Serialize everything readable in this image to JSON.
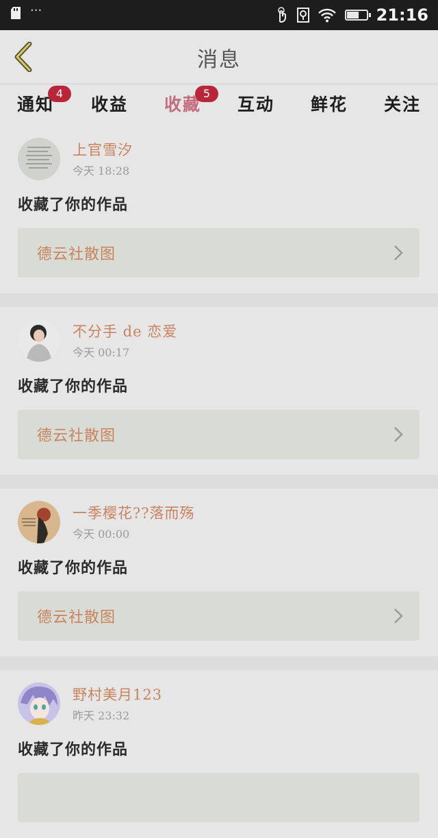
{
  "status_bar": {
    "time": "21:16",
    "dots": "···",
    "battery_level": 0.6
  },
  "header": {
    "title": "消息"
  },
  "tabs": [
    {
      "label": "通知",
      "badge": "4"
    },
    {
      "label": "收益",
      "badge": ""
    },
    {
      "label": "收藏",
      "badge": "5",
      "active": true
    },
    {
      "label": "互动",
      "badge": ""
    },
    {
      "label": "鲜花",
      "badge": ""
    },
    {
      "label": "关注",
      "badge": ""
    }
  ],
  "items": [
    {
      "name": "上官雪汐",
      "time": "今天 18:28",
      "action": "收藏了你的作品",
      "work": "德云社散图"
    },
    {
      "name": "不分手 de 恋爱",
      "time": "今天 00:17",
      "action": "收藏了你的作品",
      "work": "德云社散图"
    },
    {
      "name": "一季樱花??落而殇",
      "time": "今天 00:00",
      "action": "收藏了你的作品",
      "work": "德云社散图"
    },
    {
      "name": "野村美月123",
      "time": "昨天 23:32",
      "action": "收藏了你的作品",
      "work": ""
    }
  ],
  "colors": {
    "accent": "#c46b7e",
    "badge": "#b8263a",
    "name": "#c9825e"
  }
}
